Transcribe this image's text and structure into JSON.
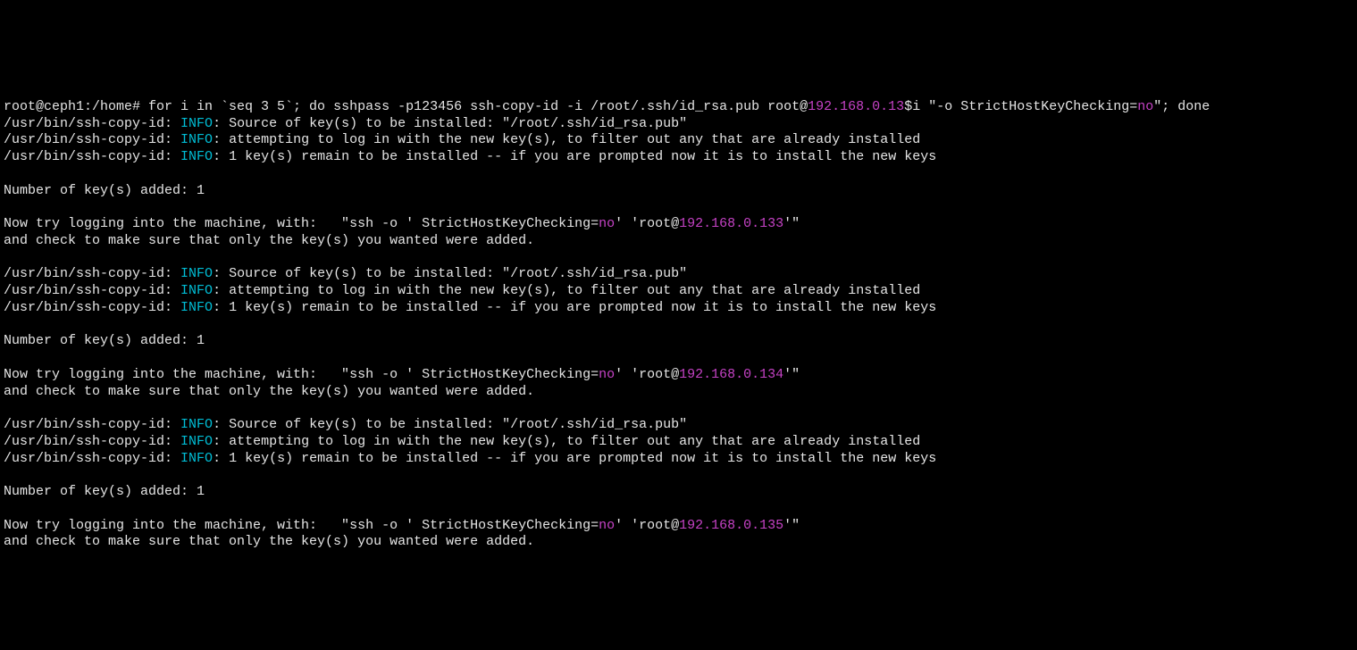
{
  "prompt": "root@ceph1:/home# ",
  "cmd_before_ip": "for i in `seq 3 5`; do sshpass -p123456 ssh-copy-id -i /root/.ssh/id_rsa.pub root@",
  "ip_prefix": "192.168.0.13",
  "cmd_after_ip_before_no": "$i \"-o StrictHostKeyChecking=",
  "no_word": "no",
  "cmd_after_no": "\"; done",
  "script_path": "/usr/bin/ssh-copy-id: ",
  "info_label": "INFO",
  "colon_space": ": ",
  "src_line": "Source of key(s) to be installed: \"/root/.ssh/id_rsa.pub\"",
  "attempt_line": "attempting to log in with the new key(s), to filter out any that are already installed",
  "remain_line": "1 key(s) remain to be installed -- if you are prompted now it is to install the new keys",
  "added_line": "Number of key(s) added: 1",
  "try_prefix": "Now try logging into the machine, with:   \"ssh -o ' StrictHostKeyChecking=",
  "try_mid": "' 'root@",
  "try_suffix": "'\"",
  "check_line": "and check to make sure that only the key(s) you wanted were added.",
  "ips": [
    "192.168.0.133",
    "192.168.0.134",
    "192.168.0.135"
  ]
}
